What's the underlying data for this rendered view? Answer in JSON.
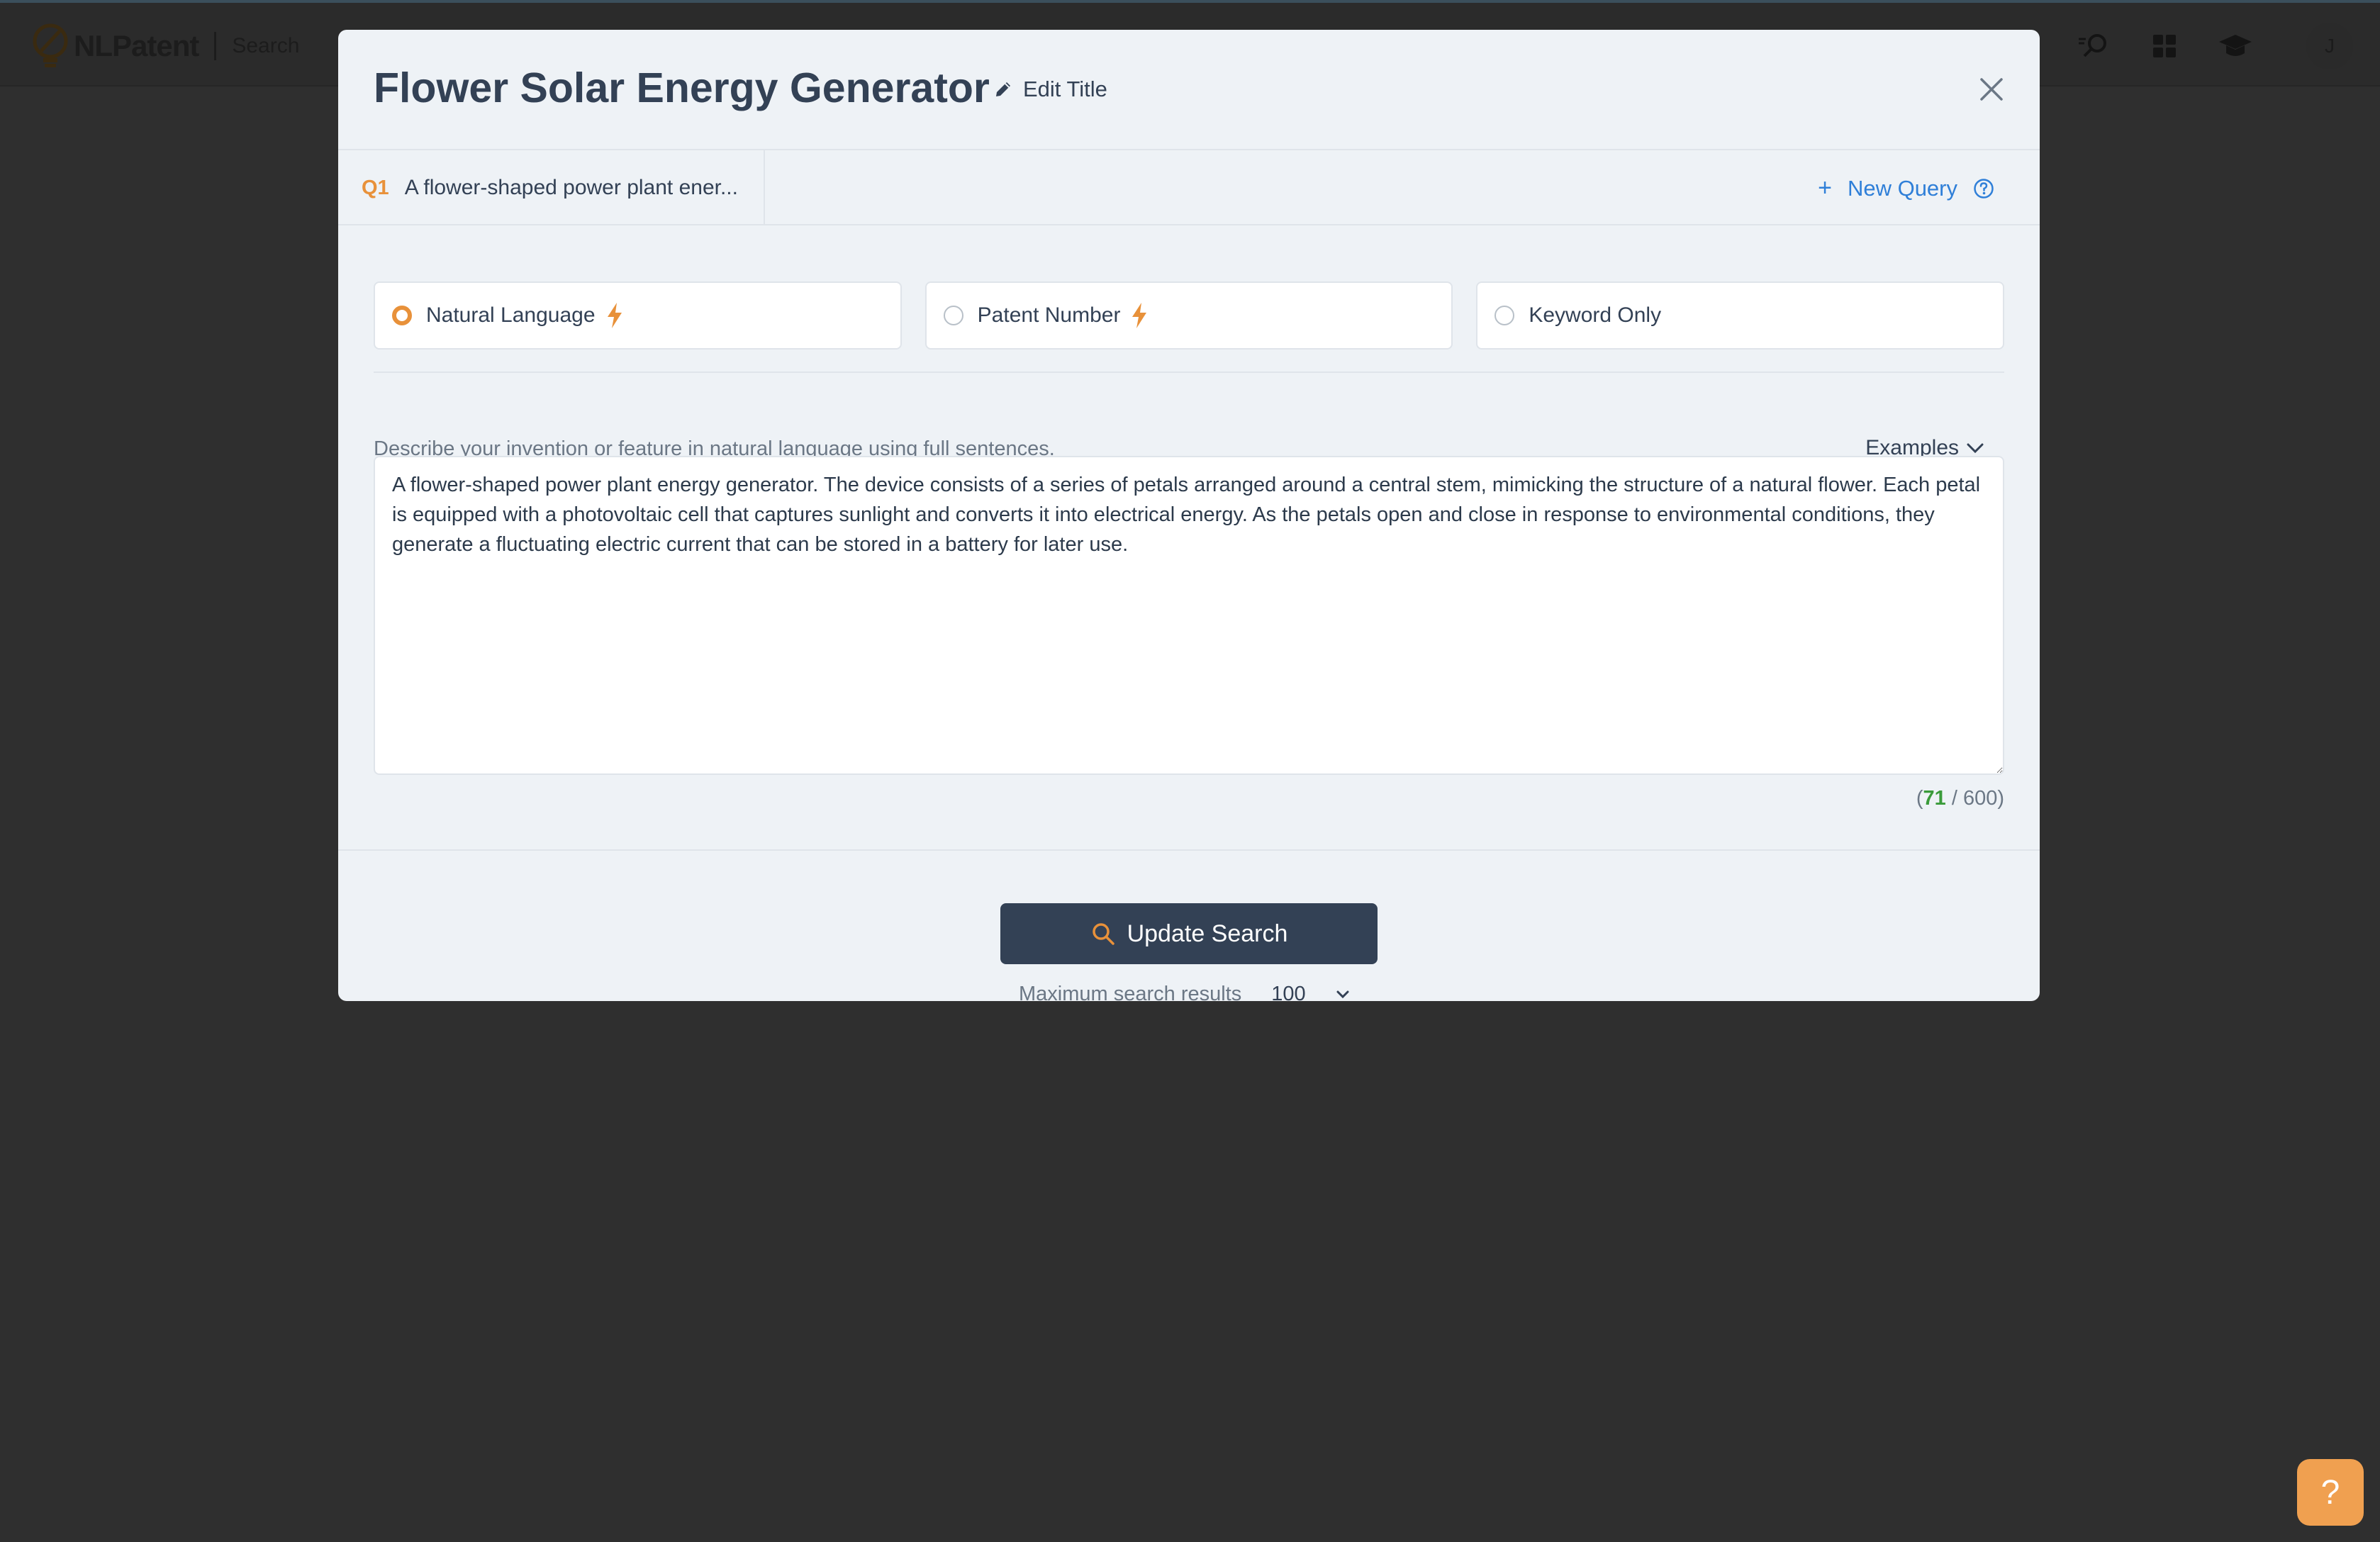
{
  "app": {
    "logo_text": "NLPatent",
    "section": "Search",
    "avatar_initial": "J",
    "header_icons": [
      "search-feedback-icon",
      "grid-apps-icon",
      "graduation-cap-icon"
    ]
  },
  "modal": {
    "title": "Flower Solar Energy Generator",
    "edit_title_label": "Edit Title",
    "tabs": [
      {
        "number": "Q1",
        "label": "A flower-shaped power plant ener..."
      }
    ],
    "new_query_label": "New Query",
    "modes": [
      {
        "label": "Natural Language",
        "selected": true,
        "ai": true
      },
      {
        "label": "Patent Number",
        "selected": false,
        "ai": true
      },
      {
        "label": "Keyword Only",
        "selected": false,
        "ai": false
      }
    ],
    "hint": "Describe your invention or feature in natural language using full sentences.",
    "examples_label": "Examples",
    "query_text": "A flower-shaped power plant energy generator. The device consists of a series of petals arranged around a central stem, mimicking the structure of a natural flower. Each petal is equipped with a photovoltaic cell that captures sunlight and converts it into electrical energy. As the petals open and close in response to environmental conditions, they generate a fluctuating electric current that can be stored in a battery for later use.",
    "counter": {
      "open": "(",
      "current": "71",
      "separator": " / ",
      "max": "600",
      "close": ")"
    },
    "update_button_label": "Update Search",
    "max_results_label": "Maximum search results",
    "max_results_value": "100"
  },
  "help_fab_label": "?",
  "colors": {
    "accent": "#e8913a",
    "primary": "#334155",
    "link": "#2f7fd8",
    "backdrop": "#2f2f2f",
    "modal_bg": "#eef2f6"
  }
}
